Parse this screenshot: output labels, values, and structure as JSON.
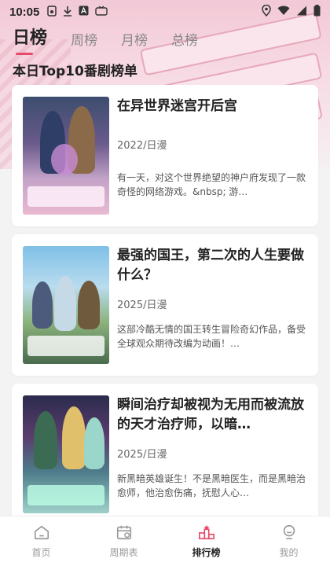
{
  "statusbar": {
    "time": "10:05"
  },
  "tabs": [
    {
      "label": "日榜",
      "active": true
    },
    {
      "label": "周榜",
      "active": false
    },
    {
      "label": "月榜",
      "active": false
    },
    {
      "label": "总榜",
      "active": false
    }
  ],
  "section_title": "本日Top10番剧榜单",
  "items": [
    {
      "title": "在异世界迷宫开后宫",
      "meta": "2022/日漫",
      "desc": "有一天，对这个世界绝望的神户府发现了一款奇怪的网络游戏。&nbsp; 游…"
    },
    {
      "title": "最强的国王，第二次的人生要做什么？",
      "meta": "2025/日漫",
      "desc": "这部冷酷无情的国王转生冒险奇幻作品，备受全球观众期待改编为动画！…"
    },
    {
      "title": "瞬间治疗却被视为无用而被流放的天才治疗师，以暗…",
      "meta": "2025/日漫",
      "desc": "新黑暗英雄诞生！不是黑暗医生，而是黑暗治愈师，他治愈伤痛，抚慰人心…"
    }
  ],
  "bottom_nav": [
    {
      "label": "首页",
      "icon": "home-icon",
      "active": false
    },
    {
      "label": "周期表",
      "icon": "calendar-icon",
      "active": false
    },
    {
      "label": "排行榜",
      "icon": "ranking-icon",
      "active": true
    },
    {
      "label": "我的",
      "icon": "profile-icon",
      "active": false
    }
  ],
  "colors": {
    "accent": "#e84a6a",
    "banner": "#f2c9d6"
  }
}
